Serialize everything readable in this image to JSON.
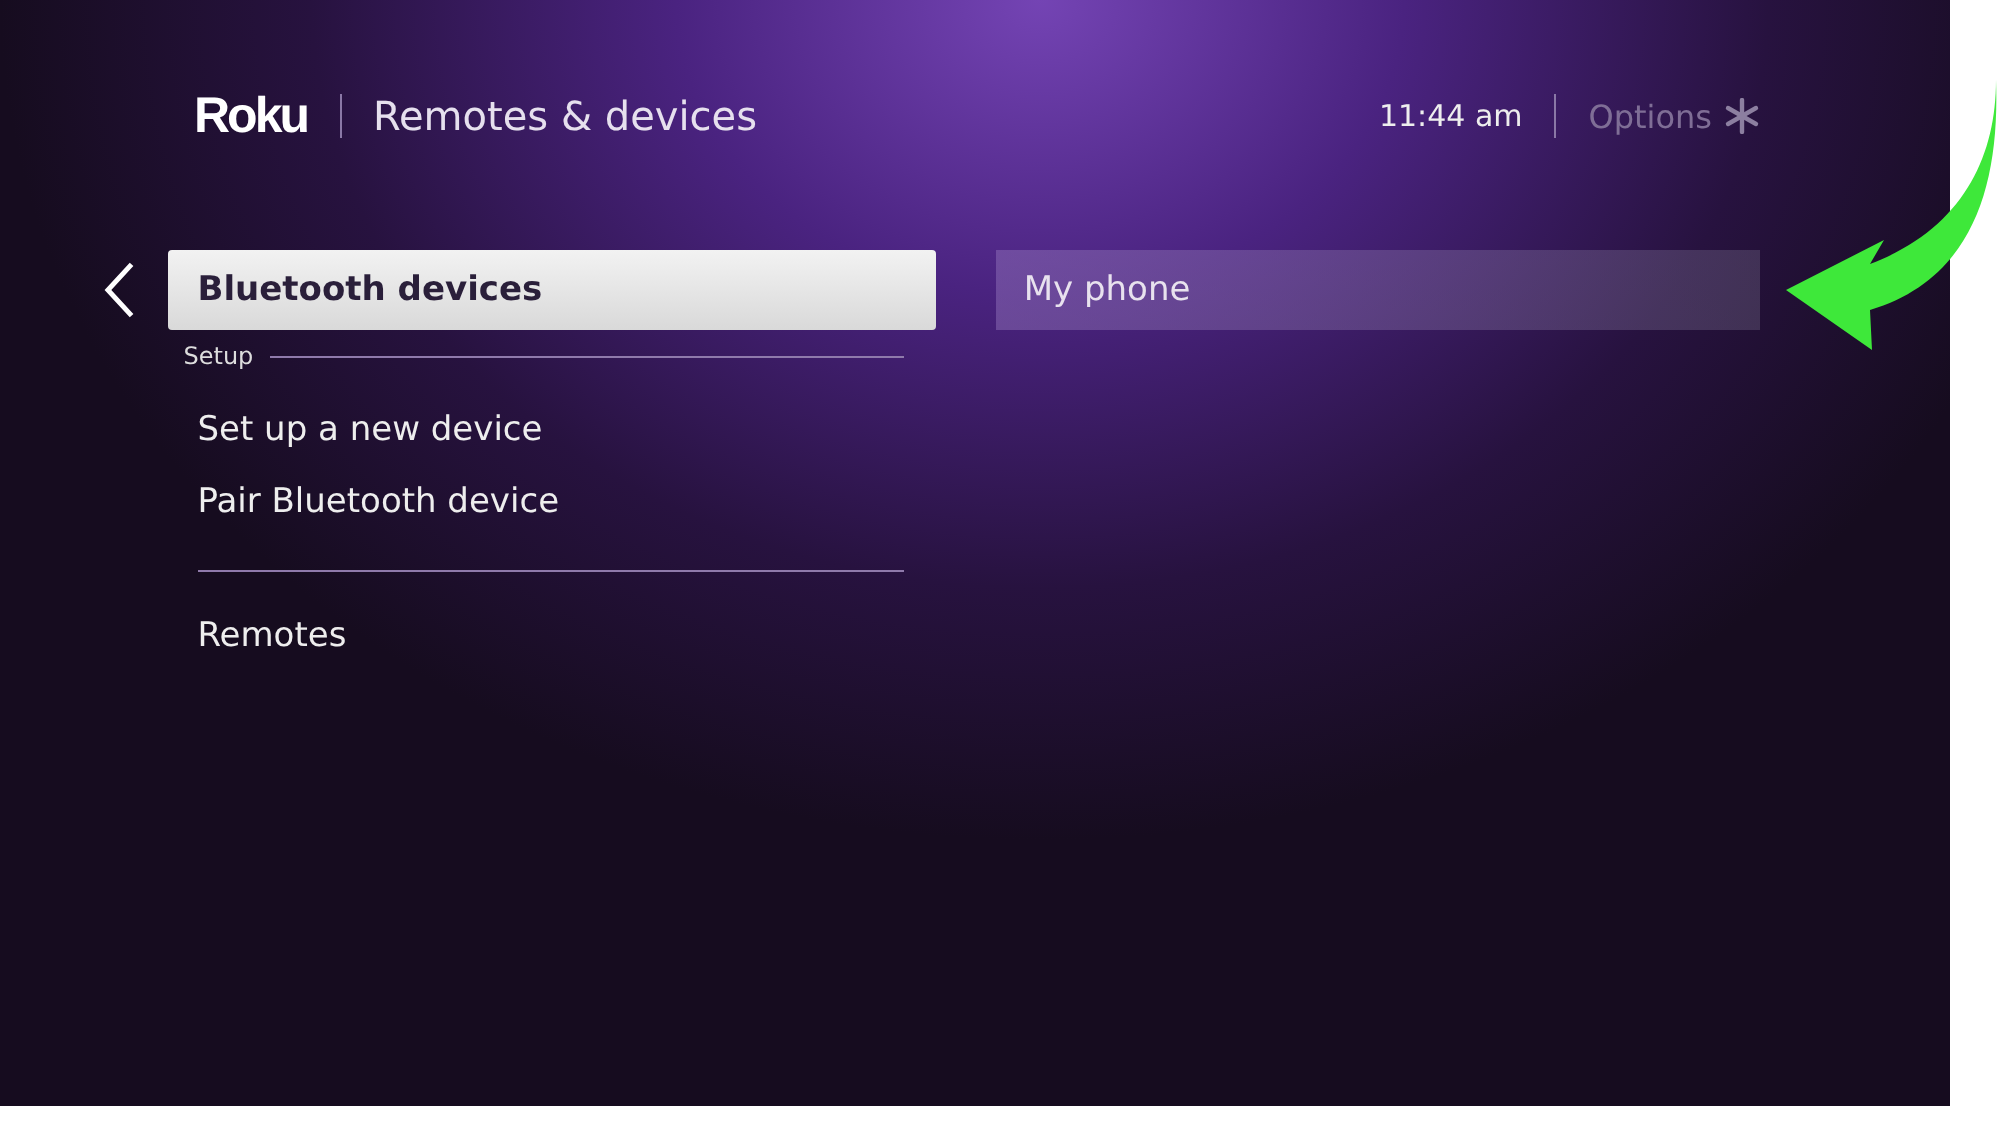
{
  "header": {
    "logo": "Roku",
    "title": "Remotes & devices",
    "time": "11:44 am",
    "options": "Options"
  },
  "menu": {
    "items": [
      {
        "kind": "item",
        "label": "Bluetooth devices",
        "selected": true
      },
      {
        "kind": "section",
        "label": "Setup"
      },
      {
        "kind": "item",
        "label": "Set up a new device",
        "selected": false
      },
      {
        "kind": "item",
        "label": "Pair Bluetooth device",
        "selected": false
      },
      {
        "kind": "divider"
      },
      {
        "kind": "item",
        "label": "Remotes",
        "selected": false
      }
    ]
  },
  "devices": [
    {
      "label": "My phone"
    }
  ]
}
